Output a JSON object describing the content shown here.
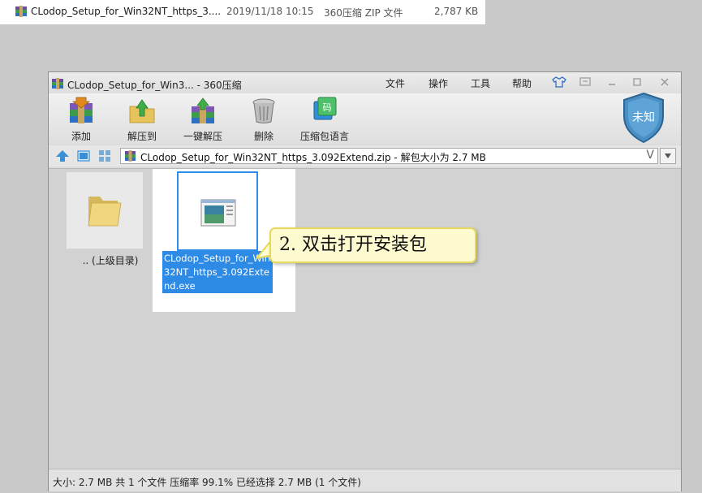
{
  "explorer_row": {
    "file_name": "CLodop_Setup_for_Win32NT_https_3....",
    "modified": "2019/11/18 10:15",
    "type": "360压缩 ZIP 文件",
    "size": "2,787 KB"
  },
  "window": {
    "title": "CLodop_Setup_for_Win3... - 360压缩",
    "menu": [
      "文件",
      "操作",
      "工具",
      "帮助"
    ]
  },
  "toolbar": {
    "add_label": "添加",
    "extract_to_label": "解压到",
    "one_click_extract_label": "一键解压",
    "delete_label": "删除",
    "language_label": "压缩包语言",
    "shield_text": "未知"
  },
  "address": {
    "path": "CLodop_Setup_for_Win32NT_https_3.092Extend.zip - 解包大小为 2.7 MB",
    "chevron": "V"
  },
  "content": {
    "parent_label": ".. (上级目录)",
    "exe_name": "CLodop_Setup_for_Win32NT_https_3.092Extend.exe",
    "callout": "2. 双击打开安装包"
  },
  "status": {
    "text": "大小: 2.7 MB 共 1 个文件 压缩率 99.1% 已经选择 2.7 MB (1 个文件)"
  },
  "colors": {
    "selection": "#2d8ae5",
    "callout_bg": "#fdfbcf",
    "shield": "#4a8fc4"
  }
}
